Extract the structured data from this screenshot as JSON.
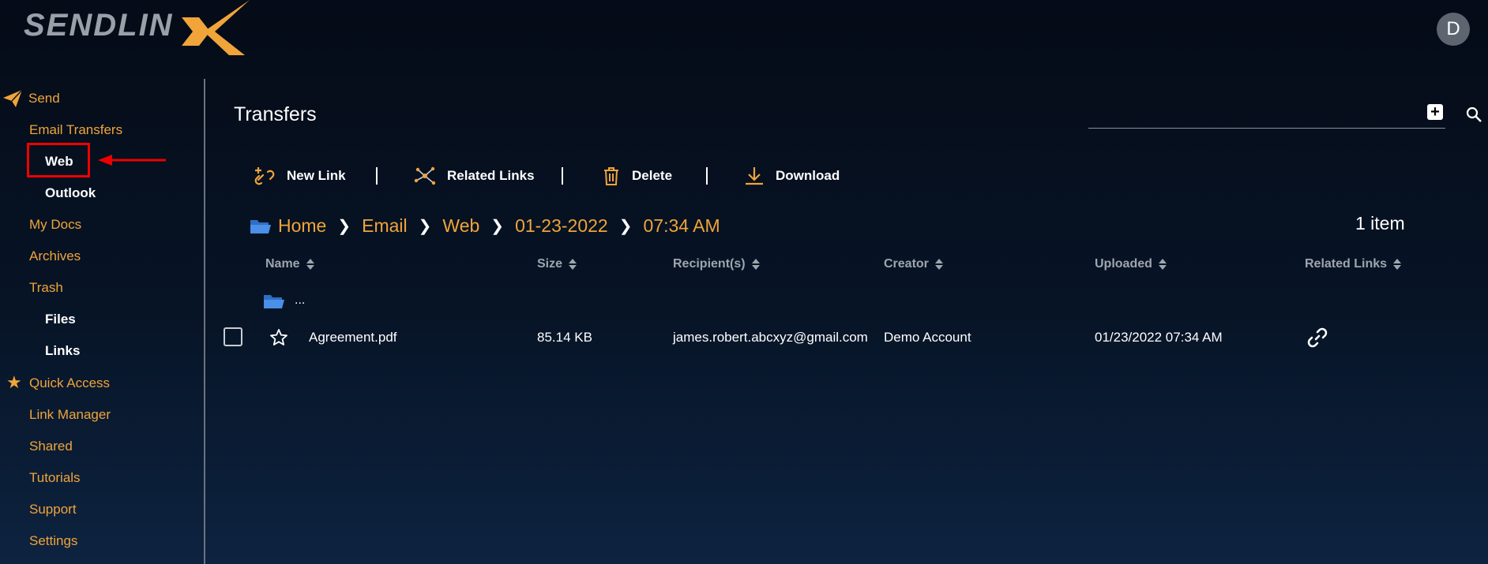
{
  "header": {
    "logo_text": "SENDLIN",
    "avatar_initial": "D"
  },
  "sidebar": {
    "items": [
      {
        "label": "Send",
        "icon": "paper-plane-icon"
      },
      {
        "label": "Email Transfers"
      },
      {
        "label": "Web"
      },
      {
        "label": "Outlook"
      },
      {
        "label": "My Docs"
      },
      {
        "label": "Archives"
      },
      {
        "label": "Trash"
      },
      {
        "label": "Files"
      },
      {
        "label": "Links"
      },
      {
        "label": "Quick Access",
        "icon": "star-icon"
      },
      {
        "label": "Link Manager"
      },
      {
        "label": "Shared"
      },
      {
        "label": "Tutorials"
      },
      {
        "label": "Support"
      },
      {
        "label": "Settings"
      }
    ]
  },
  "main": {
    "title": "Transfers",
    "search": {
      "placeholder": ""
    },
    "toolbar": {
      "new_link": "New Link",
      "related_links": "Related Links",
      "delete": "Delete",
      "download": "Download"
    },
    "breadcrumb": [
      "Home",
      "Email",
      "Web",
      "01-23-2022",
      "07:34 AM"
    ],
    "item_count": "1 item",
    "columns": [
      "Name",
      "Size",
      "Recipient(s)",
      "Creator",
      "Uploaded",
      "Related Links"
    ],
    "parent_folder_label": "...",
    "rows": [
      {
        "name": "Agreement.pdf",
        "size": "85.14 KB",
        "recipient": "james.robert.abcxyz@gmail.com",
        "creator": "Demo Account",
        "uploaded": "01/23/2022 07:34 AM"
      }
    ]
  },
  "colors": {
    "accent": "#f0a43a",
    "highlight": "#e00000",
    "folder": "#4a8fe8"
  }
}
